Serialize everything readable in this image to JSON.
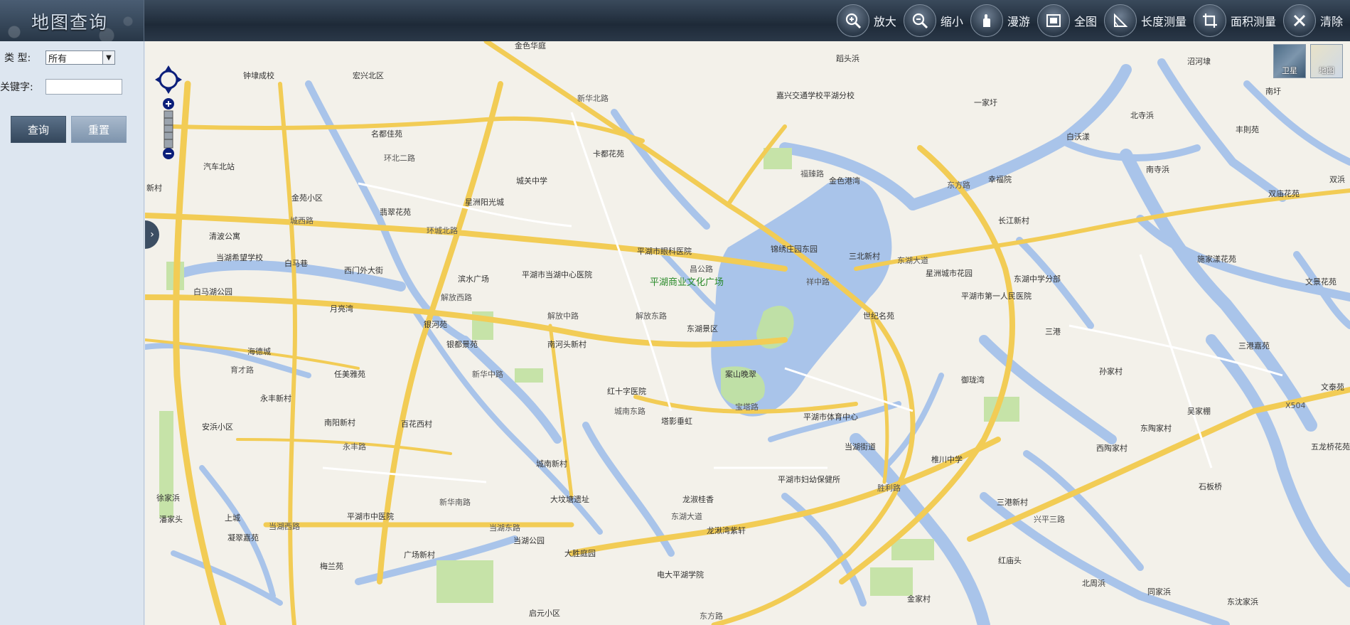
{
  "header": {
    "title": "地图查询",
    "tools": [
      {
        "label": "放大",
        "icon": "zoom-in-icon"
      },
      {
        "label": "缩小",
        "icon": "zoom-out-icon"
      },
      {
        "label": "漫游",
        "icon": "pan-icon"
      },
      {
        "label": "全图",
        "icon": "full-extent-icon"
      },
      {
        "label": "长度测量",
        "icon": "measure-length-icon"
      },
      {
        "label": "面积测量",
        "icon": "measure-area-icon"
      },
      {
        "label": "清除",
        "icon": "clear-icon"
      }
    ]
  },
  "sidebar": {
    "type_label": "类  型:",
    "type_value": "所有",
    "keyword_label": "关键字:",
    "keyword_value": "",
    "query_button": "查询",
    "reset_button": "重置"
  },
  "map": {
    "layer_switch": {
      "satellite": "卫星",
      "map": "地图"
    },
    "labels": [
      {
        "t": "钟埭成校"
      },
      {
        "t": "宏兴北区"
      },
      {
        "t": "名都佳苑"
      },
      {
        "t": "金色华庭"
      },
      {
        "t": "卡都花苑"
      },
      {
        "t": "城关中学"
      },
      {
        "t": "星洲阳光城"
      },
      {
        "t": "翡翠花苑"
      },
      {
        "t": "金苑小区"
      },
      {
        "t": "清波公寓"
      },
      {
        "t": "当湖希望学校"
      },
      {
        "t": "白马巷"
      },
      {
        "t": "白马湖公园"
      },
      {
        "t": "西门外大街"
      },
      {
        "t": "月亮湾"
      },
      {
        "t": "滨水广场"
      },
      {
        "t": "平湖市当湖中心医院"
      },
      {
        "t": "平湖市眼科医院"
      },
      {
        "t": "平湖商业文化广场"
      },
      {
        "t": "银河苑"
      },
      {
        "t": "银都景苑"
      },
      {
        "t": "南河头新村"
      },
      {
        "t": "东湖景区"
      },
      {
        "t": "海德城"
      },
      {
        "t": "任美雅苑"
      },
      {
        "t": "永丰新村"
      },
      {
        "t": "安浜小区"
      },
      {
        "t": "南阳新村"
      },
      {
        "t": "百花西村"
      },
      {
        "t": "红十字医院"
      },
      {
        "t": "塔影垂虹"
      },
      {
        "t": "案山晚翠"
      },
      {
        "t": "平湖市体育中心"
      },
      {
        "t": "城南新村"
      },
      {
        "t": "大坟塘遗址"
      },
      {
        "t": "龙淑桂香"
      },
      {
        "t": "平湖市妇幼保健所"
      },
      {
        "t": "当湖街道"
      },
      {
        "t": "上城"
      },
      {
        "t": "凝翠嘉苑"
      },
      {
        "t": "平湖市中医院"
      },
      {
        "t": "梅兰苑"
      },
      {
        "t": "广场新村"
      },
      {
        "t": "当湖公园"
      },
      {
        "t": "大胜庭园"
      },
      {
        "t": "电大平湖学院"
      },
      {
        "t": "龙湫湾紫轩"
      },
      {
        "t": "嘉兴交通学校平湖分校"
      },
      {
        "t": "金色港湾"
      },
      {
        "t": "锦绣庄园东园"
      },
      {
        "t": "三北新村"
      },
      {
        "t": "星洲城市花园"
      },
      {
        "t": "世纪名苑"
      },
      {
        "t": "平湖市第一人民医院"
      },
      {
        "t": "御珑湾"
      },
      {
        "t": "椎川中学"
      },
      {
        "t": "三港新村"
      },
      {
        "t": "长江新村"
      },
      {
        "t": "东湖中学分部"
      },
      {
        "t": "一家圩"
      },
      {
        "t": "幸福院"
      },
      {
        "t": "白沃漾"
      },
      {
        "t": "北寺浜"
      },
      {
        "t": "南寺浜"
      },
      {
        "t": "丰則苑"
      },
      {
        "t": "双庙花苑"
      },
      {
        "t": "施家漾花苑"
      },
      {
        "t": "三港嘉苑"
      },
      {
        "t": "孙家村"
      },
      {
        "t": "吴家棚"
      },
      {
        "t": "东陶家村"
      },
      {
        "t": "西陶家村"
      },
      {
        "t": "石板桥"
      },
      {
        "t": "红庙头"
      },
      {
        "t": "北周浜"
      },
      {
        "t": "同家浜"
      },
      {
        "t": "东沈家浜"
      },
      {
        "t": "金家村"
      },
      {
        "t": "五龙桥花苑"
      },
      {
        "t": "文泰苑"
      },
      {
        "t": "文景花苑"
      },
      {
        "t": "沼河埭"
      },
      {
        "t": "南圩"
      },
      {
        "t": "双浜"
      },
      {
        "t": "三港"
      },
      {
        "t": "蹈头浜"
      },
      {
        "t": "汽车北站"
      },
      {
        "t": "新村"
      },
      {
        "t": "徐家浜"
      },
      {
        "t": "潘家头"
      },
      {
        "t": "启元小区"
      }
    ],
    "roads": [
      "环北二路",
      "城西路",
      "环城北路",
      "昌公路",
      "解放西路",
      "解放中路",
      "解放东路",
      "新华北路",
      "新华中路",
      "新华南路",
      "育才路",
      "永丰路",
      "当湖西路",
      "当湖东路",
      "东湖大道",
      "城南东路",
      "宝塔路",
      "东方路",
      "福臻路",
      "胜利路",
      "东湖大道",
      "祥中路",
      "东方路",
      "X504",
      "兴平三路"
    ]
  }
}
